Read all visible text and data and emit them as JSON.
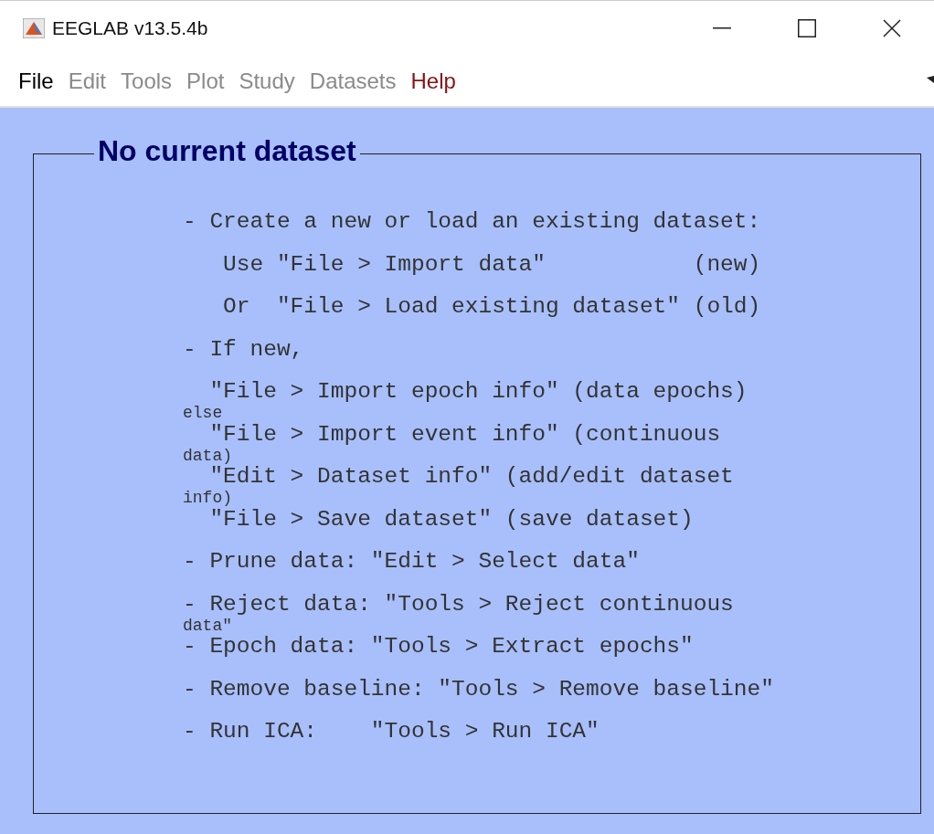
{
  "window": {
    "title": "EEGLAB v13.5.4b"
  },
  "menu": [
    {
      "label": "File",
      "kind": "enabled"
    },
    {
      "label": "Edit",
      "kind": "disabled"
    },
    {
      "label": "Tools",
      "kind": "disabled"
    },
    {
      "label": "Plot",
      "kind": "disabled"
    },
    {
      "label": "Study",
      "kind": "disabled"
    },
    {
      "label": "Datasets",
      "kind": "disabled"
    },
    {
      "label": "Help",
      "kind": "help"
    }
  ],
  "panel": {
    "title": "No current dataset",
    "lines": [
      {
        "text": "- Create a new or load an existing dataset:"
      },
      {
        "text": "   Use \"File > Import data\"           (new)"
      },
      {
        "text": "   Or  \"File > Load existing dataset\" (old)"
      },
      {
        "text": "- If new,"
      },
      {
        "text": "  \"File > Import epoch info\" (data epochs)",
        "wrap": "else"
      },
      {
        "text": "  \"File > Import event info\" (continuous",
        "wrap": "data)"
      },
      {
        "text": "  \"Edit > Dataset info\" (add/edit dataset",
        "wrap": "info)"
      },
      {
        "text": "  \"File > Save dataset\" (save dataset)"
      },
      {
        "text": "- Prune data: \"Edit > Select data\""
      },
      {
        "text": "- Reject data: \"Tools > Reject continuous",
        "wrap": "data\""
      },
      {
        "text": "- Epoch data: \"Tools > Extract epochs\""
      },
      {
        "text": "- Remove baseline: \"Tools > Remove baseline\""
      },
      {
        "text": "- Run ICA:    \"Tools > Run ICA\""
      }
    ]
  }
}
